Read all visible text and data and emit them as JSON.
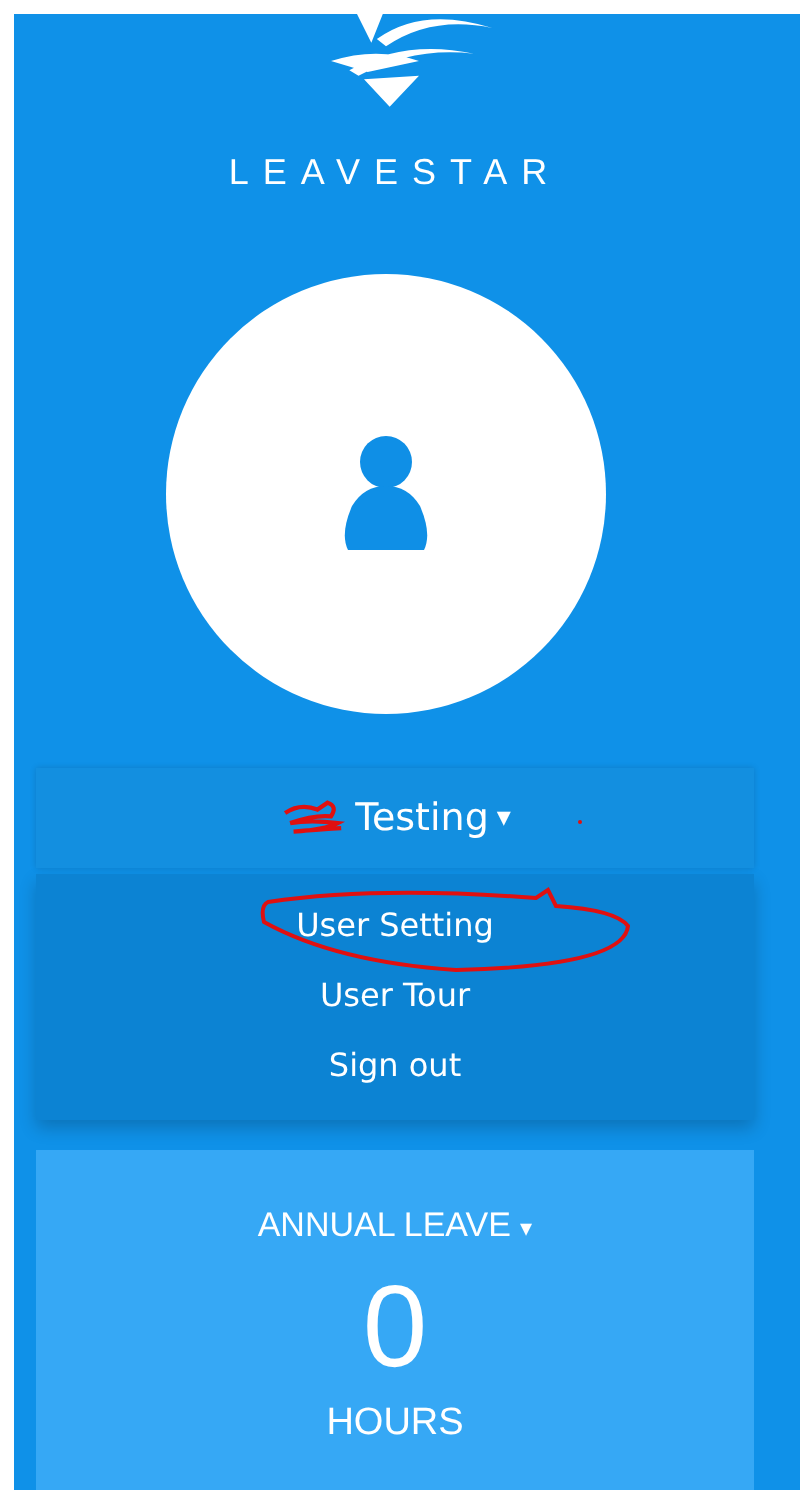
{
  "brand": {
    "name": "LEAVESTAR"
  },
  "user": {
    "name": "Testing",
    "caret": "▾",
    "menu_open": true
  },
  "user_menu": [
    {
      "label": "User Setting",
      "circled": true
    },
    {
      "label": "User Tour",
      "circled": false
    },
    {
      "label": "Sign out",
      "circled": false
    }
  ],
  "leave_card": {
    "type": "ANNUAL LEAVE",
    "caret": "▾",
    "value": "0",
    "unit": "HOURS"
  }
}
